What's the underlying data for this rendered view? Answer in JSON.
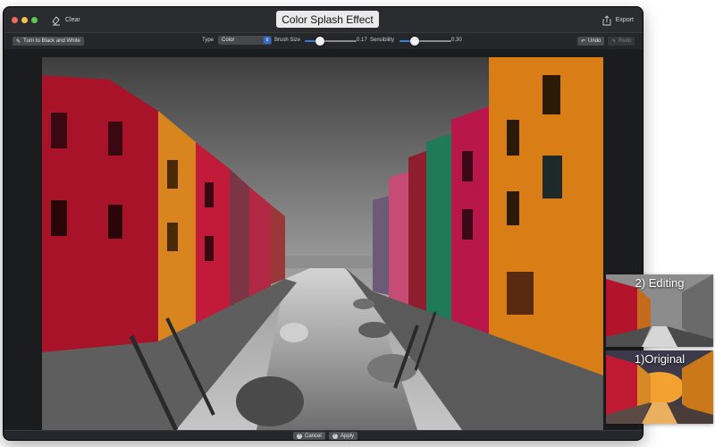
{
  "window": {
    "title": "Color Splash Effect",
    "clear_label": "Clear",
    "export_label": "Export"
  },
  "toolbar": {
    "bw_button": "Turn to Black and White",
    "type_label": "Type",
    "type_value": "Color",
    "brush_label": "Brush Size",
    "brush_value": "0.17",
    "sensibility_label": "Sensibility",
    "sensibility_value": "0.30",
    "undo_label": "Undo",
    "redo_label": "Redo"
  },
  "sliders": {
    "brush_fraction": 0.3,
    "sensibility_fraction": 0.3
  },
  "footer": {
    "cancel_label": "Cancel",
    "apply_label": "Apply"
  },
  "thumbnails": {
    "editing_label": "2) Editing",
    "original_label": "1)Original"
  },
  "colors": {
    "accent": "#2f6ed8",
    "window_bg": "#1f2022",
    "titlebar": "#2b2c2f"
  }
}
